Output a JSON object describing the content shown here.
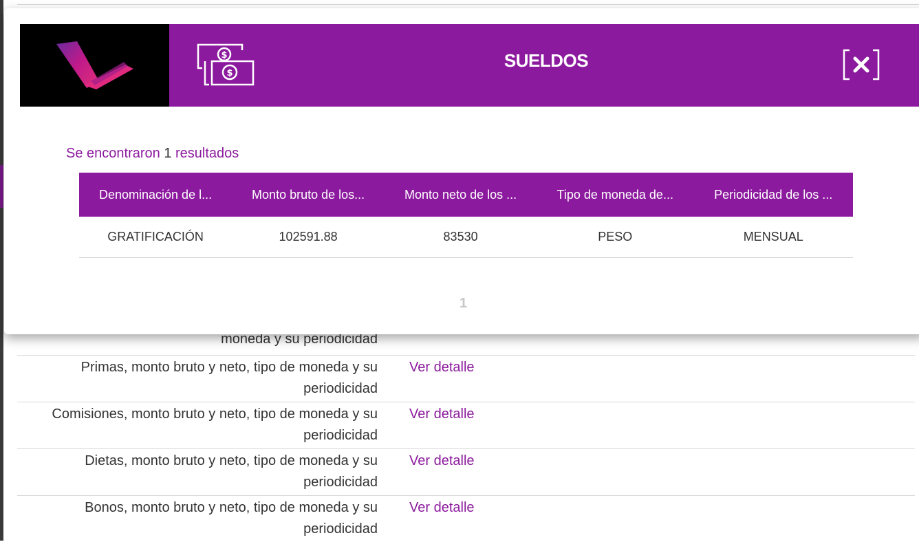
{
  "modal": {
    "title": "SUELDOS",
    "results_prefix": "Se encontraron",
    "results_count": "1",
    "results_suffix": "resultados",
    "table": {
      "headers": [
        "Denominación de l...",
        "Monto bruto de los...",
        "Monto neto de los ...",
        "Tipo de moneda de...",
        "Periodicidad de los ..."
      ],
      "rows": [
        [
          "GRATIFICACIÓN",
          "102591.88",
          "83530",
          "PESO",
          "MENSUAL"
        ]
      ]
    },
    "page": "1"
  },
  "background_list": {
    "items": [
      {
        "label": "moneda y su periodicidad",
        "link": ""
      },
      {
        "label": "Primas, monto bruto y neto, tipo de moneda y su periodicidad",
        "link": "Ver detalle"
      },
      {
        "label": "Comisiones, monto bruto y neto, tipo de moneda y su periodicidad",
        "link": "Ver detalle"
      },
      {
        "label": "Dietas, monto bruto y neto, tipo de moneda y su periodicidad",
        "link": "Ver detalle"
      },
      {
        "label": "Bonos, monto bruto y neto, tipo de moneda y su periodicidad",
        "link": "Ver detalle"
      }
    ]
  },
  "colors": {
    "brand": "#8c1a9e",
    "text": "#333333",
    "divider": "#d8d8d8"
  },
  "icons": [
    "logo-icon",
    "money-icon",
    "close-icon"
  ]
}
